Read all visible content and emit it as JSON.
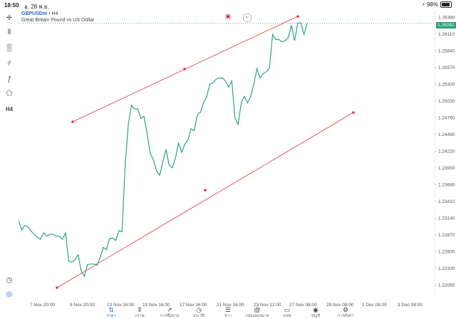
{
  "status": {
    "time": "18:50",
    "date": "อ. 28 พ.ย.",
    "battery": "98%"
  },
  "chart": {
    "symbol": "GBPUSDm",
    "separator": "•",
    "timeframe": "H4",
    "description": "Great Britain Pound vs US Dollar",
    "bid_price": "1.26282",
    "line_color": "#2aa876",
    "channel_color": "#e0393b"
  },
  "toolbar": {
    "items": [
      "crosshair-icon",
      "candles-icon",
      "bars-icon",
      "indicators-icon",
      "function-icon",
      "objects-icon"
    ],
    "timeframe_label": "H4"
  },
  "price_axis": [
    "1.26380",
    "1.26110",
    "1.25840",
    "1.25570",
    "1.25300",
    "1.25030",
    "1.24760",
    "1.24490",
    "1.24220",
    "1.23950",
    "1.23680",
    "1.23410",
    "1.23140",
    "1.22870",
    "1.22600",
    "1.22330",
    "1.22060"
  ],
  "time_axis": [
    "7 Nov 20:00",
    "9 Nov 20:00",
    "13 Nov 16:00",
    "15 Nov 16:00",
    "17 Nov 16:00",
    "21 Nov 16:00",
    "23 Nov 12:00",
    "27 Nov 08:00",
    "29 Nov 08:00",
    "1 Dec 08:00",
    "3 Dec 08:00"
  ],
  "chart_data": {
    "type": "line",
    "ylim": [
      1.2195,
      1.2645
    ],
    "y": [
      1.231,
      1.2295,
      1.2302,
      1.23,
      1.2293,
      1.2288,
      1.2283,
      1.228,
      1.229,
      1.2285,
      1.2288,
      1.2288,
      1.2285,
      1.2285,
      1.228,
      1.229,
      1.2245,
      1.2243,
      1.2247,
      1.2255,
      1.2229,
      1.222,
      1.2239,
      1.224,
      1.224,
      1.2238,
      1.225,
      1.2267,
      1.2263,
      1.2281,
      1.2282,
      1.2278,
      1.2294,
      1.2292,
      1.24,
      1.2465,
      1.2496,
      1.249,
      1.249,
      1.2475,
      1.2478,
      1.245,
      1.2418,
      1.2408,
      1.239,
      1.2383,
      1.2405,
      1.2425,
      1.24,
      1.2395,
      1.241,
      1.2435,
      1.242,
      1.2433,
      1.244,
      1.2458,
      1.2455,
      1.248,
      1.2485,
      1.25,
      1.251,
      1.253,
      1.2532,
      1.2538,
      1.254,
      1.254,
      1.2535,
      1.2525,
      1.2535,
      1.2475,
      1.2465,
      1.25,
      1.251,
      1.25,
      1.251,
      1.253,
      1.2555,
      1.254,
      1.2547,
      1.255,
      1.2556,
      1.261,
      1.2602,
      1.2602,
      1.2598,
      1.26,
      1.2605,
      1.2625,
      1.26,
      1.2628,
      1.2629,
      1.261,
      1.2628
    ]
  }
}
